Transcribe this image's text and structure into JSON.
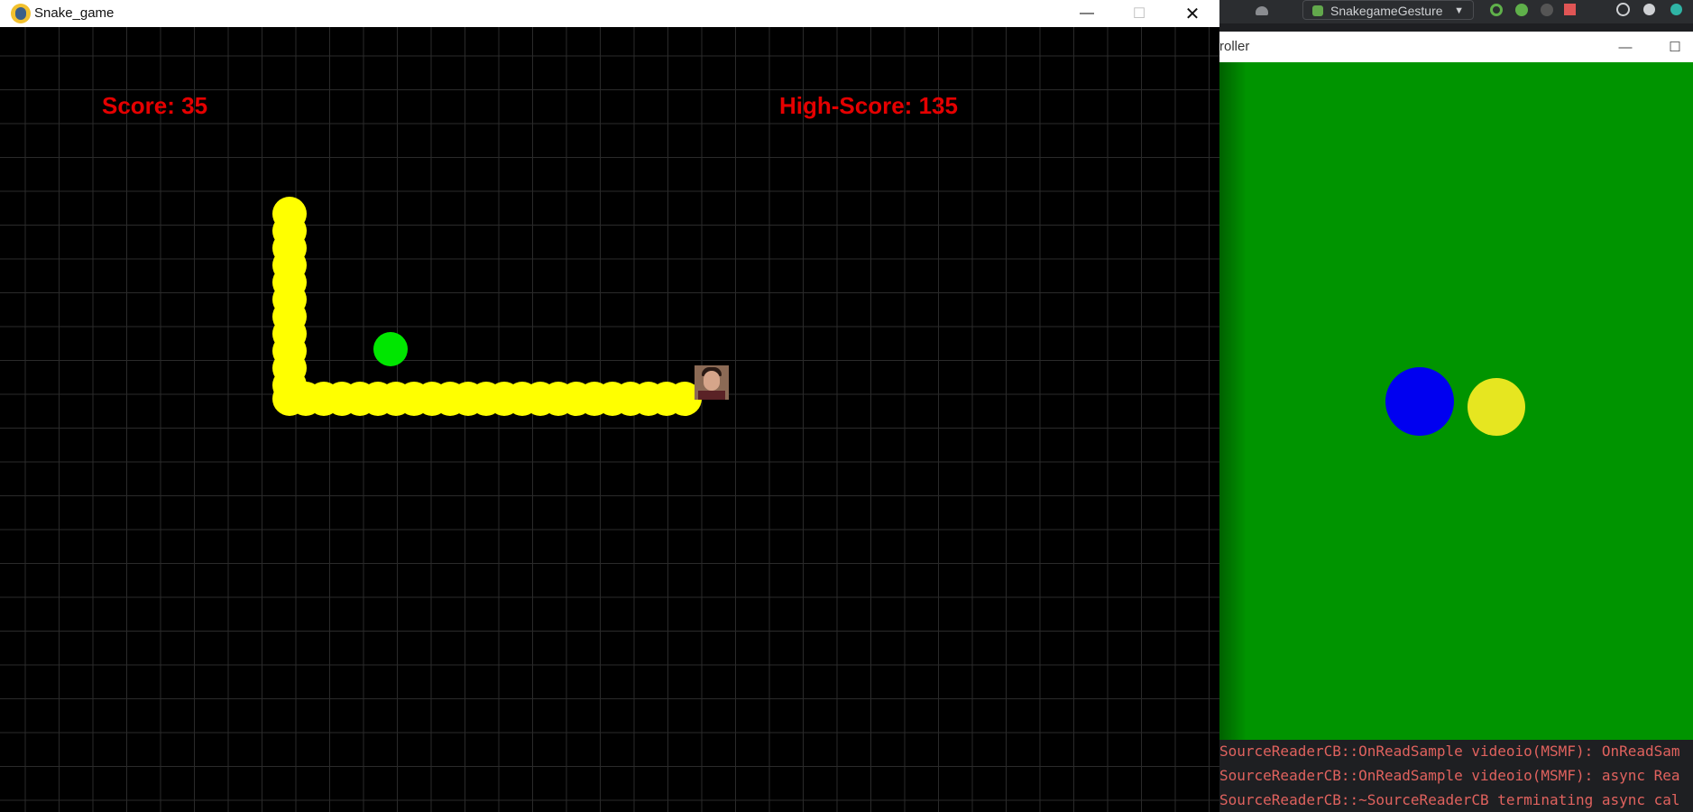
{
  "game_window": {
    "title": "Snake_game",
    "minimize_symbol": "—",
    "maximize_symbol": "☐",
    "close_symbol": "✕",
    "score_text": "Score: 35",
    "highscore_text": "High-Score: 135",
    "colors": {
      "background": "#000000",
      "grid": "#2a2a2a",
      "snake": "#ffff00",
      "food": "#00e600",
      "score": "#e50000"
    }
  },
  "ide": {
    "run_config_label": "SnakegameGesture",
    "run_config_chevron": "▼"
  },
  "controller_window": {
    "title_fragment": "roller",
    "minimize_symbol": "—",
    "maximize_symbol": "☐",
    "colors": {
      "background": "#009400",
      "left_ball": "#0000f0",
      "right_ball": "#e6e620"
    }
  },
  "console": {
    "lines": [
      "SourceReaderCB::OnReadSample videoio(MSMF): OnReadSam",
      "SourceReaderCB::OnReadSample videoio(MSMF): async Rea",
      "SourceReaderCB::~SourceReaderCB terminating async cal"
    ],
    "color": "#e0625e"
  }
}
